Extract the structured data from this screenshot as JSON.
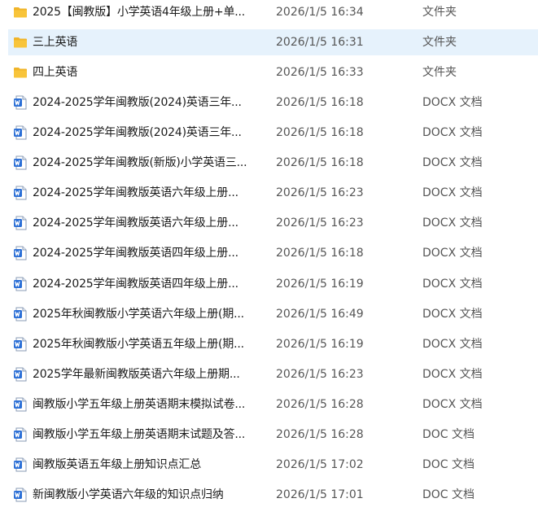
{
  "files": [
    {
      "name": "2025【闽教版】小学英语4年级上册+单...",
      "date": "2026/1/5 16:34",
      "type": "文件夹",
      "icon": "folder-icon"
    },
    {
      "name": "三上英语",
      "date": "2026/1/5 16:31",
      "type": "文件夹",
      "icon": "folder-icon",
      "selected": true
    },
    {
      "name": "四上英语",
      "date": "2026/1/5 16:33",
      "type": "文件夹",
      "icon": "folder-icon"
    },
    {
      "name": "2024-2025学年闽教版(2024)英语三年...",
      "date": "2026/1/5 16:18",
      "type": "DOCX 文档",
      "icon": "word-doc-icon"
    },
    {
      "name": "2024-2025学年闽教版(2024)英语三年...",
      "date": "2026/1/5 16:18",
      "type": "DOCX 文档",
      "icon": "word-doc-icon"
    },
    {
      "name": "2024-2025学年闽教版(新版)小学英语三...",
      "date": "2026/1/5 16:18",
      "type": "DOCX 文档",
      "icon": "word-doc-icon"
    },
    {
      "name": "2024-2025学年闽教版英语六年级上册...",
      "date": "2026/1/5 16:23",
      "type": "DOCX 文档",
      "icon": "word-doc-icon"
    },
    {
      "name": "2024-2025学年闽教版英语六年级上册...",
      "date": "2026/1/5 16:23",
      "type": "DOCX 文档",
      "icon": "word-doc-icon"
    },
    {
      "name": "2024-2025学年闽教版英语四年级上册...",
      "date": "2026/1/5 16:18",
      "type": "DOCX 文档",
      "icon": "word-doc-icon"
    },
    {
      "name": "2024-2025学年闽教版英语四年级上册...",
      "date": "2026/1/5 16:19",
      "type": "DOCX 文档",
      "icon": "word-doc-icon"
    },
    {
      "name": "2025年秋闽教版小学英语六年级上册(期...",
      "date": "2026/1/5 16:49",
      "type": "DOCX 文档",
      "icon": "word-doc-icon"
    },
    {
      "name": "2025年秋闽教版小学英语五年级上册(期...",
      "date": "2026/1/5 16:19",
      "type": "DOCX 文档",
      "icon": "word-doc-icon"
    },
    {
      "name": "2025学年最新闽教版英语六年级上册期...",
      "date": "2026/1/5 16:23",
      "type": "DOCX 文档",
      "icon": "word-doc-icon"
    },
    {
      "name": "闽教版小学五年级上册英语期末模拟试卷...",
      "date": "2026/1/5 16:28",
      "type": "DOCX 文档",
      "icon": "word-doc-icon"
    },
    {
      "name": "闽教版小学五年级上册英语期末试题及答...",
      "date": "2026/1/5 16:28",
      "type": "DOC 文档",
      "icon": "word-doc-icon"
    },
    {
      "name": "闽教版英语五年级上册知识点汇总",
      "date": "2026/1/5 17:02",
      "type": "DOC 文档",
      "icon": "word-doc-icon"
    },
    {
      "name": "新闽教版小学英语六年级的知识点归纳",
      "date": "2026/1/5 17:01",
      "type": "DOC 文档",
      "icon": "word-doc-icon"
    }
  ],
  "colors": {
    "selection": "#e6f2fc",
    "folder": "#f8c43a",
    "word": "#2b6fd6"
  }
}
